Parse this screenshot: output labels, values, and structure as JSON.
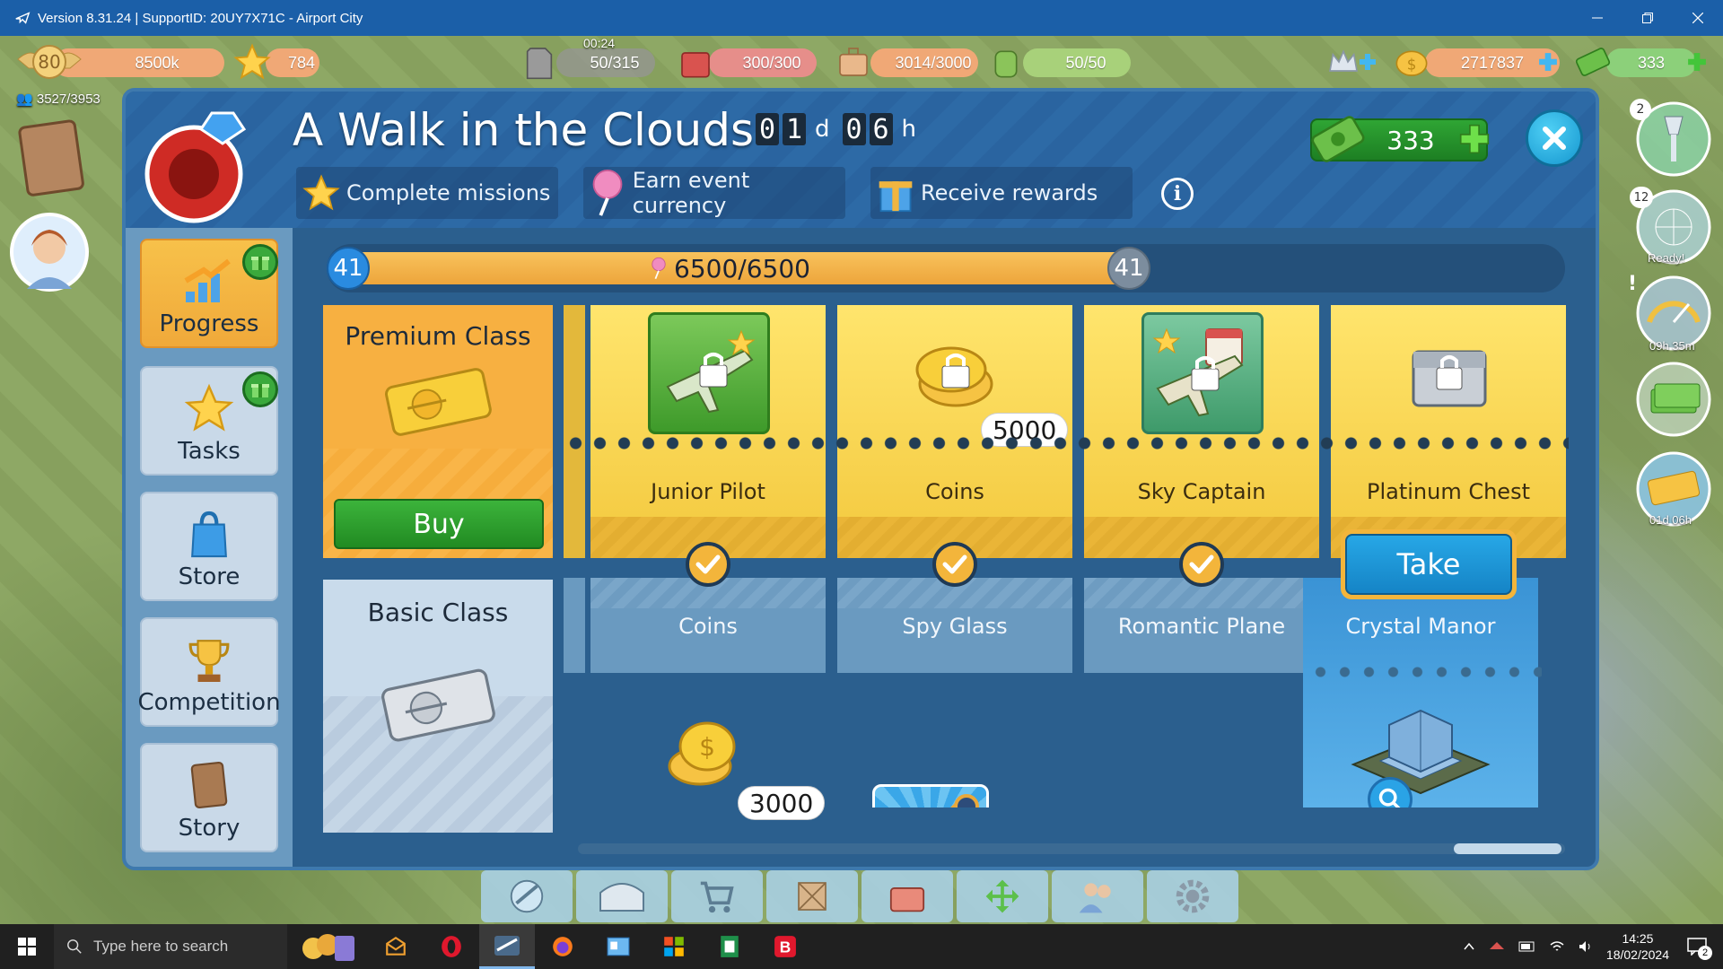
{
  "window": {
    "title": "Version 8.31.24 | SupportID: 20UY7X71C - Airport City",
    "minimize": "—",
    "maximize": "❐",
    "close": "✕"
  },
  "resources": {
    "level": "80",
    "xp": "8500k",
    "stars": "784",
    "fuel_timer": "00:24",
    "fuel": "50/315",
    "cargo": "300/300",
    "storage": "3014/3000",
    "crew": "50/50",
    "coins": "2717837",
    "cash": "333",
    "population": "3527/3953"
  },
  "right_side": {
    "badge_2": "2",
    "badge_12": "12",
    "ready_label": "Ready!",
    "alert": "!",
    "gauge_timer": "09h 35m",
    "ticket_timer": "01d 06h"
  },
  "event": {
    "title": "A Walk in the Clouds",
    "timer_days": [
      "0",
      "1"
    ],
    "days_unit": "d",
    "timer_hours": [
      "0",
      "6"
    ],
    "hours_unit": "h",
    "steps": [
      "Complete missions",
      "Earn event currency",
      "Receive rewards"
    ],
    "info": "i",
    "cash": "333"
  },
  "nav": [
    {
      "label": "Progress",
      "active": true,
      "gift": true
    },
    {
      "label": "Tasks",
      "active": false,
      "gift": true
    },
    {
      "label": "Store",
      "active": false,
      "gift": false
    },
    {
      "label": "Competition",
      "active": false,
      "gift": false
    },
    {
      "label": "Story",
      "active": false,
      "gift": false
    }
  ],
  "progress": {
    "level_left": "41",
    "level_right": "41",
    "text": "6500/6500",
    "fraction": 1.0
  },
  "premium_class": {
    "title": "Premium Class",
    "buy_label": "Buy"
  },
  "basic_class": {
    "title": "Basic Class"
  },
  "premium_rewards": [
    {
      "label": "Junior Pilot",
      "amount": ""
    },
    {
      "label": "Coins",
      "amount": "5000"
    },
    {
      "label": "Sky Captain",
      "amount": ""
    },
    {
      "label": "Platinum Chest",
      "amount": ""
    }
  ],
  "basic_rewards": [
    {
      "label": "Coins",
      "amount": "3000",
      "claimed": true
    },
    {
      "label": "Spy Glass",
      "amount": "",
      "claimed": true
    },
    {
      "label": "Romantic Plane",
      "amount": "",
      "claimed": true
    },
    {
      "label": "Crystal Manor",
      "amount": "",
      "claimed": false
    }
  ],
  "take_label": "Take",
  "taskbar": {
    "search_placeholder": "Type here to search",
    "time": "14:25",
    "date": "18/02/2024",
    "notifications": "2"
  }
}
